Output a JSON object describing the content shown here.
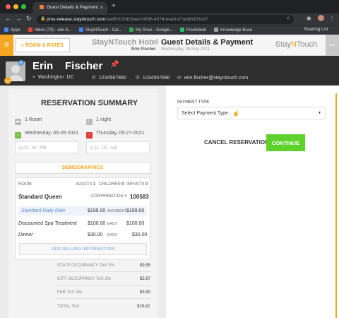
{
  "browser": {
    "tab_title": "Guest Details & Payment",
    "url_host": "pms-release.stayntouch.com",
    "url_path": "/staff/h/20d15aed-b598-4574-bea6-d7addb303cb7",
    "bookmarks": [
      {
        "label": "Apps",
        "color": "#4a8af4"
      },
      {
        "label": "Inbox (73) - erin.fi...",
        "color": "#ea4335"
      },
      {
        "label": "StayNTouch - Cal...",
        "color": "#4285f4"
      },
      {
        "label": "My Drive - Google...",
        "color": "#34a853"
      },
      {
        "label": "Freshdesk",
        "color": "#25c16f"
      },
      {
        "label": "Knowledge Base",
        "color": "#9e9e9e"
      }
    ],
    "reading_list": "Reading List"
  },
  "header": {
    "back_label": "ROOM & RATES",
    "hotel": "StayNTouch Hotel",
    "title": "Guest Details & Payment",
    "user": "Erin Fischer",
    "date": "Wednesday, 26 May 2021",
    "brand_a": "Stay",
    "brand_b": "N",
    "brand_c": "Touch"
  },
  "guest": {
    "first_name": "Erin",
    "last_name": "Fischer",
    "city": "Washington",
    "state": "DC",
    "phone1": "1234567890",
    "phone2": "1234567890",
    "email": "erin.fischer@stayntouch.com"
  },
  "summary": {
    "title": "RESERVATION SUMMARY",
    "rooms": "1 Room",
    "nights": "1 night",
    "checkin": "Wednesday, 05-26-2021",
    "checkout": "Thursday, 05-27-2021",
    "checkin_time": "03 : 00 : PM",
    "checkout_time": "11 : 00 : AM",
    "demographics": "DEMOGRAPHICS",
    "room_label": "ROOM",
    "adults_label": "ADULTS",
    "adults": "1",
    "children_label": "CHILDREN",
    "children": "0",
    "infants_label": "INFANTS",
    "infants": "0",
    "room_type": "Standard Queen",
    "confirmation_label": "CONFIRMATION #",
    "confirmation": "100583",
    "lines": [
      {
        "name": "Standard Daily Rate",
        "price": "$199.00",
        "unit": "AVG/NIGHT",
        "total": "$199.00"
      },
      {
        "name": "Discounted Spa Treatment",
        "price": "$100.00",
        "unit": "EACH",
        "total": "$100.00"
      },
      {
        "name": "Dinner",
        "price": "$30.00",
        "unit": "EACH",
        "total": "$30.00"
      }
    ],
    "add_billing": "ADD BILLING INFORMATION",
    "taxes": [
      {
        "name": "STATE OCCUPANCY TAX 5%",
        "value": "$9.95"
      },
      {
        "name": "CITY OCCUPANCY TAX 3%",
        "value": "$5.97"
      },
      {
        "name": "F&B TAX 3%",
        "value": "$3.90"
      },
      {
        "name": "TOTAL TAX",
        "value": "$19.82"
      }
    ]
  },
  "payment": {
    "label": "PAYMENT TYPE",
    "select_value": "Select Payment Type",
    "cancel": "CANCEL RESERVATION",
    "continue": "CONTINUE"
  },
  "colors": {
    "accent": "#f5a623",
    "continue": "#5fd12d",
    "dark": "#2e2e2e"
  }
}
